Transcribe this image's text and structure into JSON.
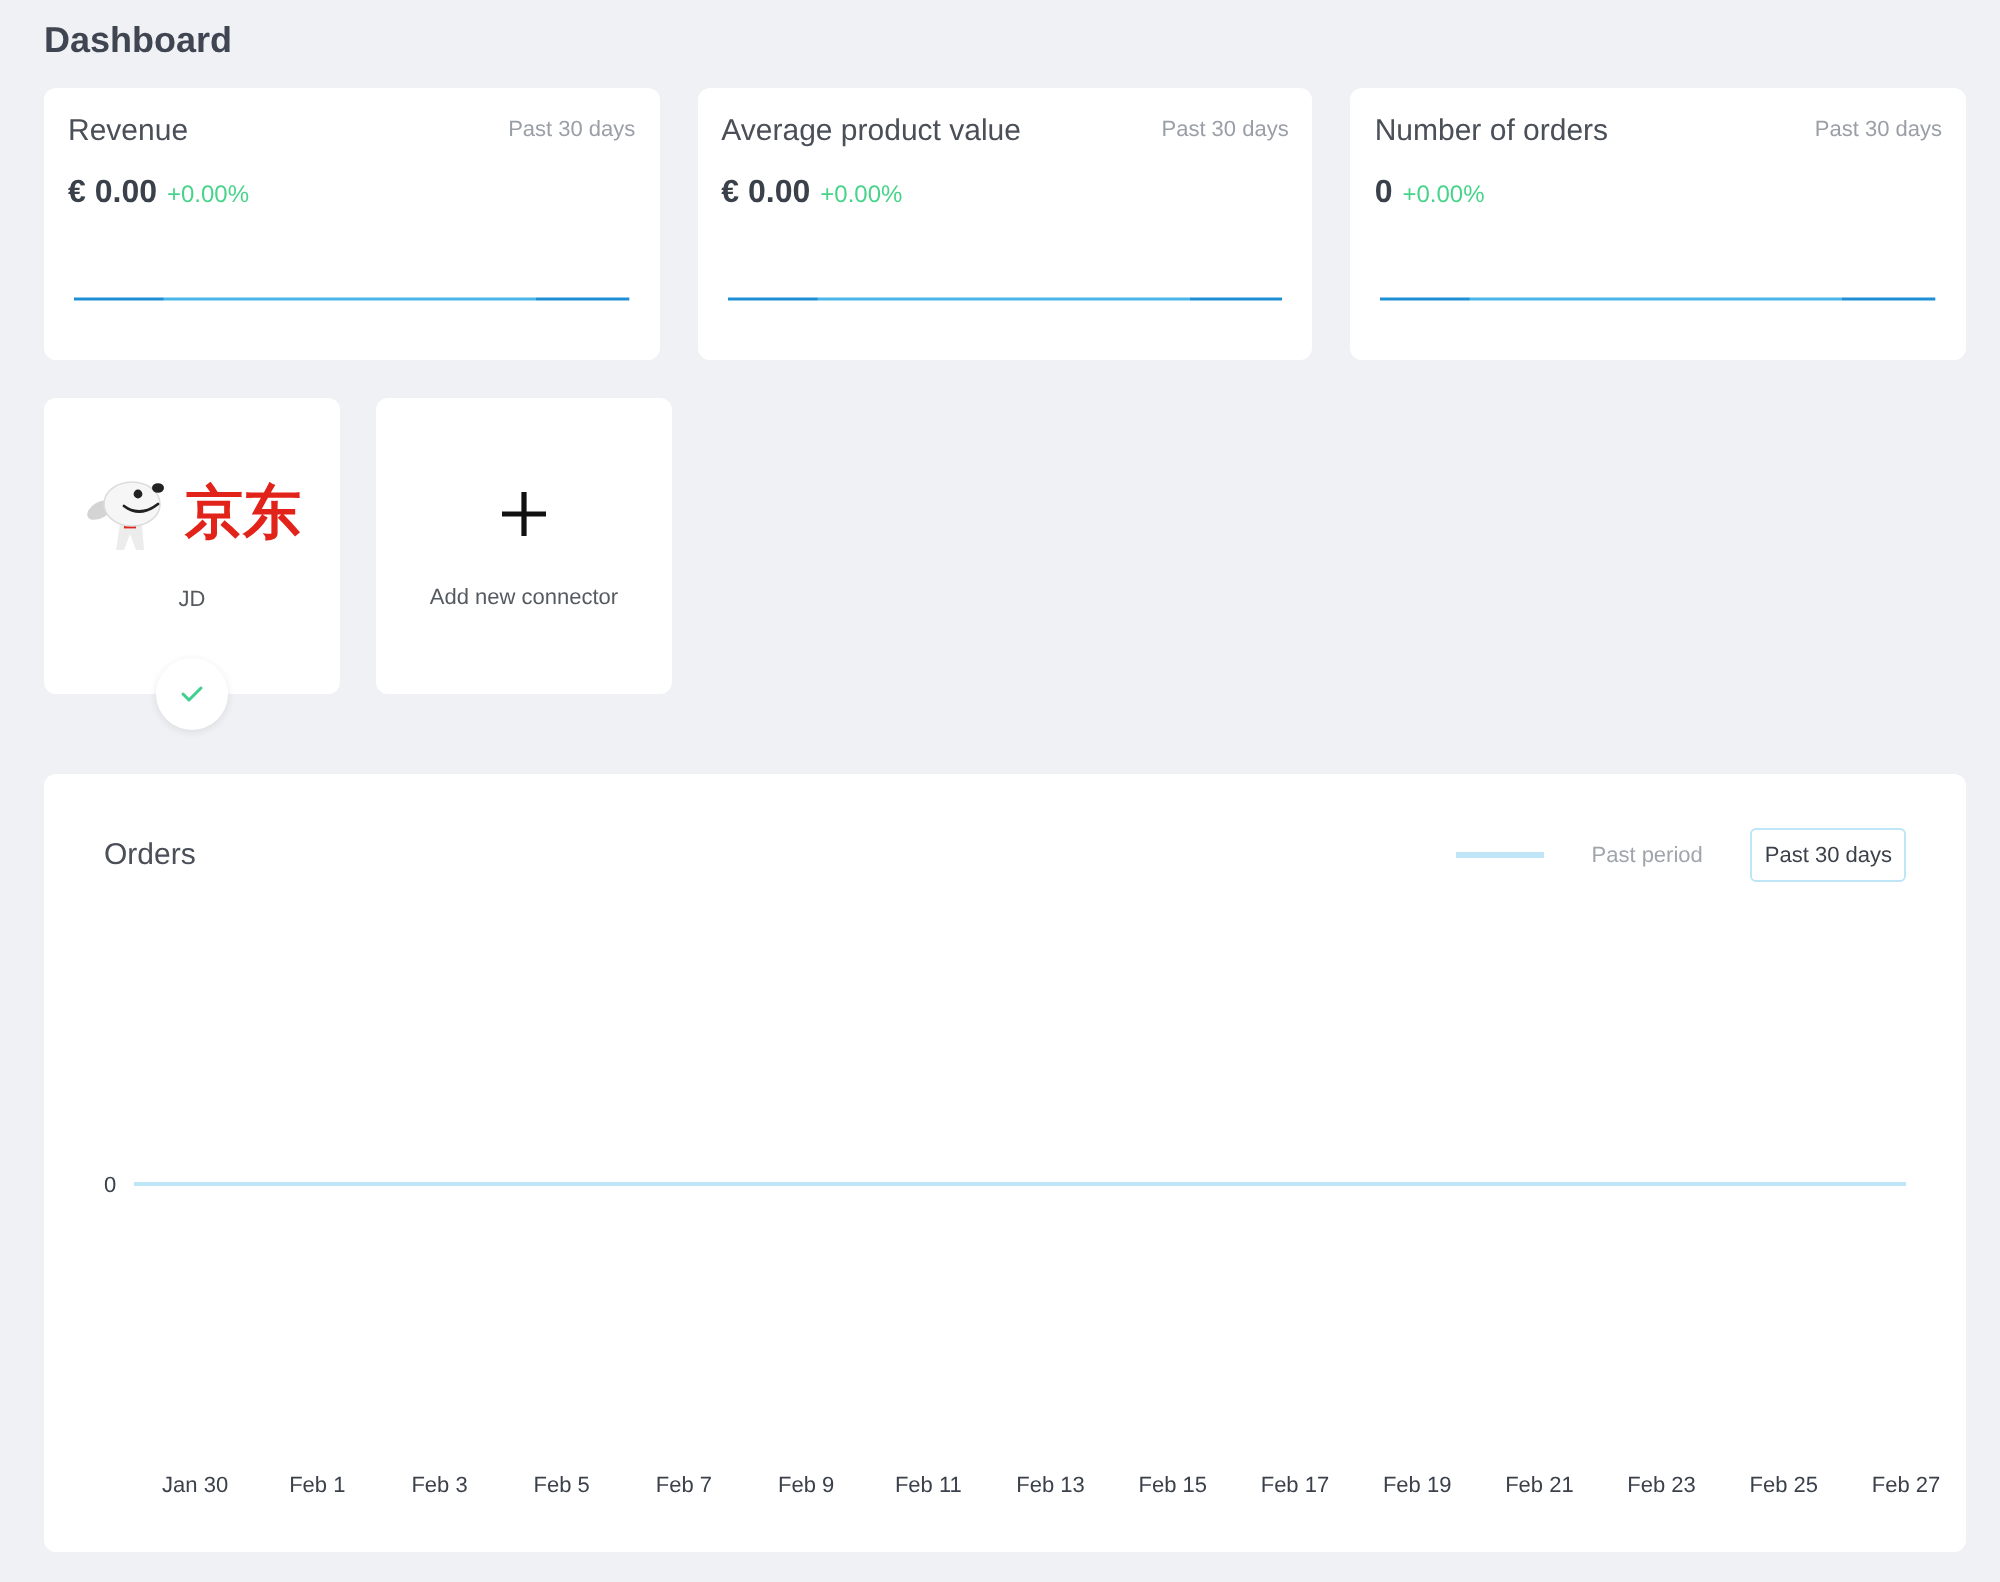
{
  "page": {
    "title": "Dashboard"
  },
  "metrics": [
    {
      "title": "Revenue",
      "period": "Past 30 days",
      "value": "€ 0.00",
      "change": "+0.00%"
    },
    {
      "title": "Average product value",
      "period": "Past 30 days",
      "value": "€ 0.00",
      "change": "+0.00%"
    },
    {
      "title": "Number of orders",
      "period": "Past 30 days",
      "value": "0",
      "change": "+0.00%"
    }
  ],
  "connectors": [
    {
      "kind": "connector",
      "logo_text": "京东",
      "name": "JD",
      "connected": true
    },
    {
      "kind": "add",
      "label": "Add new connector"
    }
  ],
  "orders_panel": {
    "title": "Orders",
    "legend_label": "Past period",
    "period_button": "Past 30 days",
    "y_axis_label": "0",
    "x_axis_labels": [
      "Jan 30",
      "Feb 1",
      "Feb 3",
      "Feb 5",
      "Feb 7",
      "Feb 9",
      "Feb 11",
      "Feb 13",
      "Feb 15",
      "Feb 17",
      "Feb 19",
      "Feb 21",
      "Feb 23",
      "Feb 25",
      "Feb 27"
    ]
  }
}
